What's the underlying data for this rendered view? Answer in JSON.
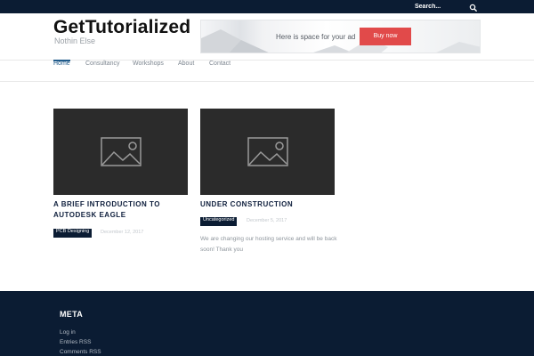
{
  "topbar": {
    "search_placeholder": "Search..."
  },
  "header": {
    "site_title": "GetTutorialized",
    "tagline": "Nothin Else",
    "ad": {
      "text": "Here is space for your ad",
      "button_label": "Buy now",
      "button_color": "#e14a4a"
    }
  },
  "nav": {
    "items": [
      {
        "label": "Home",
        "active": true
      },
      {
        "label": "Consultancy"
      },
      {
        "label": "Workshops"
      },
      {
        "label": "About"
      },
      {
        "label": "Contact"
      }
    ]
  },
  "posts": [
    {
      "title_line1": "A BRIEF INTRODUCTION TO",
      "title_line2": "AUTODESK EAGLE",
      "category": "PCB Designing",
      "date": "December 12, 2017",
      "excerpt_line1": "",
      "excerpt_line2": "",
      "thumbnail_icon": "image-placeholder-icon"
    },
    {
      "title_line1": "UNDER CONSTRUCTION",
      "title_line2": "",
      "category": "Uncategorized",
      "date": "December 5, 2017",
      "excerpt_line1": "We are changing our hosting service and will be back",
      "excerpt_line2": "soon! Thank you",
      "thumbnail_icon": "image-placeholder-icon"
    }
  ],
  "footer": {
    "meta_title": "META",
    "links": [
      {
        "label": "Log in"
      },
      {
        "label": "Entries RSS"
      },
      {
        "label": "Comments RSS"
      }
    ]
  },
  "colors": {
    "topbar": "#0b1c33",
    "accent": "#1f5a8a",
    "footer": "#0b1c33"
  }
}
